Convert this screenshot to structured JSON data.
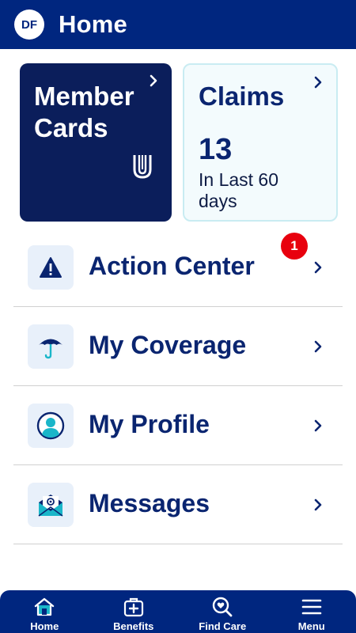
{
  "header": {
    "avatar_initials": "DF",
    "title": "Home"
  },
  "cards": {
    "member": {
      "title_line1": "Member",
      "title_line2": "Cards"
    },
    "claims": {
      "title": "Claims",
      "count": "13",
      "subtitle": "In Last 60 days"
    }
  },
  "rows": [
    {
      "label": "Action Center",
      "icon": "warning-icon",
      "badge": "1"
    },
    {
      "label": "My Coverage",
      "icon": "umbrella-icon"
    },
    {
      "label": "My Profile",
      "icon": "profile-icon"
    },
    {
      "label": "Messages",
      "icon": "envelope-icon"
    }
  ],
  "bottom_nav": [
    {
      "label": "Home",
      "icon": "home-icon"
    },
    {
      "label": "Benefits",
      "icon": "medical-kit-icon"
    },
    {
      "label": "Find Care",
      "icon": "search-care-icon"
    },
    {
      "label": "Menu",
      "icon": "hamburger-menu-icon"
    }
  ],
  "colors": {
    "brand_navy": "#00267f",
    "member_card_bg": "#0b1e5b",
    "claims_card_bg": "#f3fbfd",
    "accent_teal": "#1ab6c9",
    "badge_red": "#e8000e"
  }
}
